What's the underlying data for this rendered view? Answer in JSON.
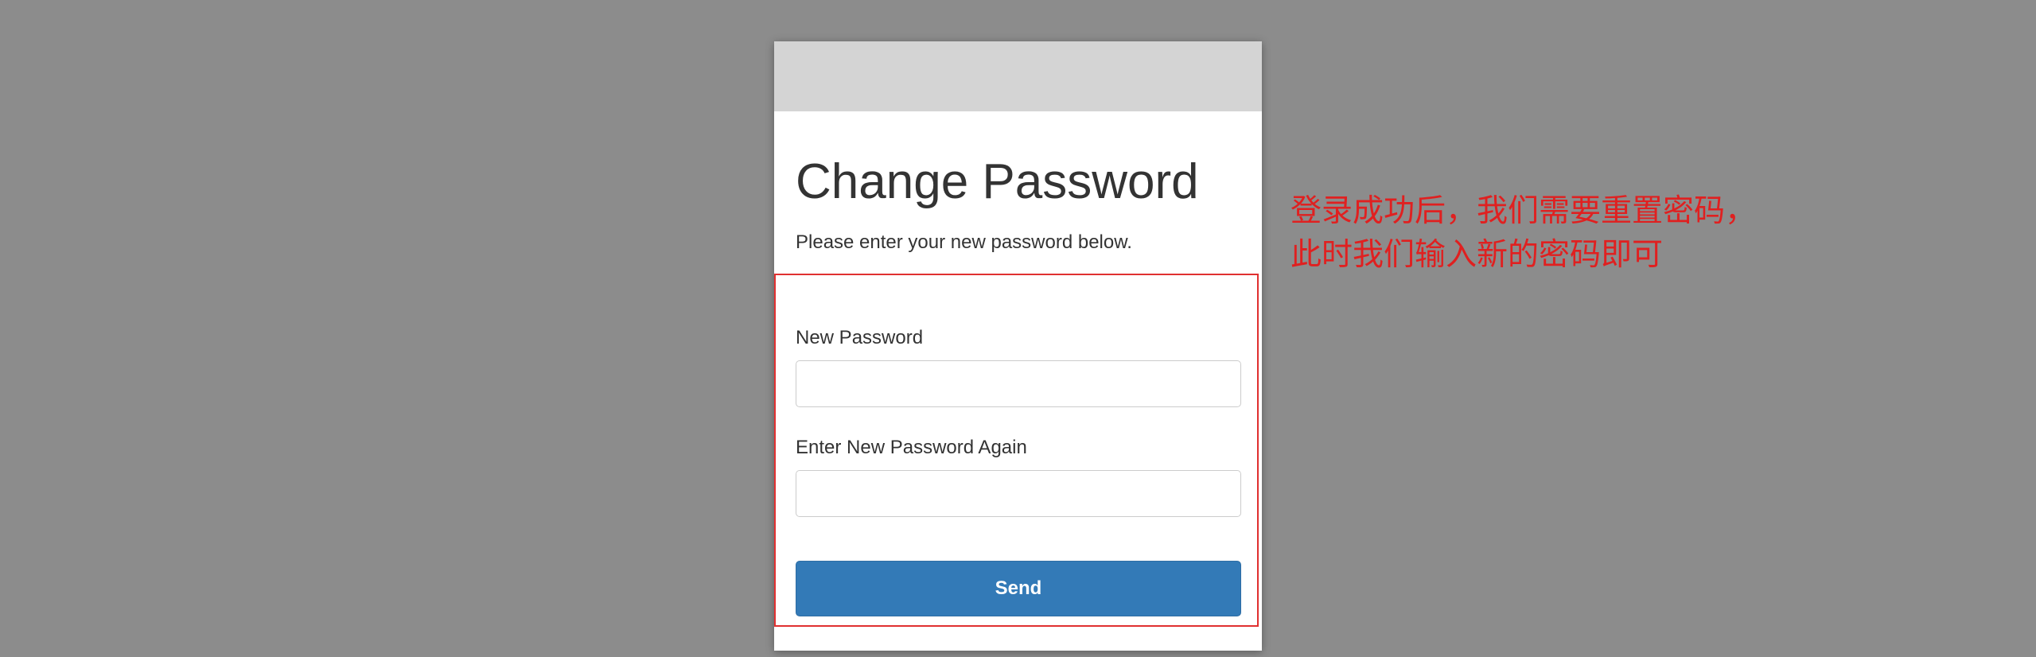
{
  "form": {
    "title": "Change Password",
    "subtitle": "Please enter your new password below.",
    "new_password_label": "New Password",
    "new_password_value": "",
    "confirm_password_label": "Enter New Password Again",
    "confirm_password_value": "",
    "send_label": "Send"
  },
  "annotation": {
    "line1": "登录成功后，我们需要重置密码，",
    "line2": "此时我们输入新的密码即可"
  },
  "colors": {
    "background": "#8c8c8c",
    "header": "#d4d4d4",
    "button": "#337ab7",
    "annotation": "#e02020"
  }
}
